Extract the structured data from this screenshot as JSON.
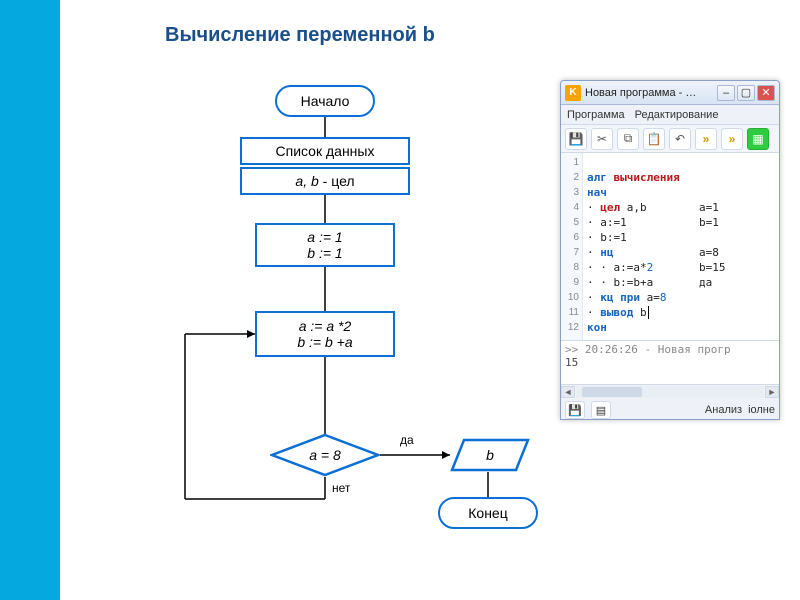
{
  "title": "Вычисление переменной b",
  "flow": {
    "start": "Начало",
    "end": "Конец",
    "data_header": "Список данных",
    "data_decl_a": "a, b",
    "data_decl_sep": " - цел",
    "init_a": "a := 1",
    "init_b": "b := 1",
    "loop_a": "a := a *2",
    "loop_b": "b := b +a",
    "cond": "a = 8",
    "output": "b",
    "yes": "да",
    "no": "нет"
  },
  "ide": {
    "window_title": "Новая программа - …",
    "menu": {
      "program": "Программа",
      "edit": "Редактирование"
    },
    "gutter": [
      "1",
      "2",
      "3",
      "4",
      "5",
      "6",
      "7",
      "8",
      "9",
      "10",
      "11",
      "12"
    ],
    "code": {
      "l1_kw": "алг",
      "l1_rest": " вычисления",
      "l2_kw": "нач",
      "l3_kw": "цел",
      "l3_rest": " a,b",
      "l4": "a:=1",
      "l5": "b:=1",
      "l6_kw": "нц",
      "l7_pre": "a:=a*",
      "l7_num": "2",
      "l8": "b:=b+a",
      "l9_kw": "кц при",
      "l9_rest": " a=",
      "l9_num": "8",
      "l10_kw": "вывод",
      "l10_rest": " b",
      "l11_kw": "кон"
    },
    "side": {
      "r4": "a=1",
      "r5": "b=1",
      "r7": "a=8",
      "r8": "b=15",
      "r9": "да"
    },
    "console_line1": ">> 20:26:26 - Новая прогр",
    "console_line2": "15",
    "status_analysis": "Анализ",
    "status_full": "iолне"
  },
  "colors": {
    "accent": "#0b6fd6",
    "sidebar": "#06a8e0"
  }
}
